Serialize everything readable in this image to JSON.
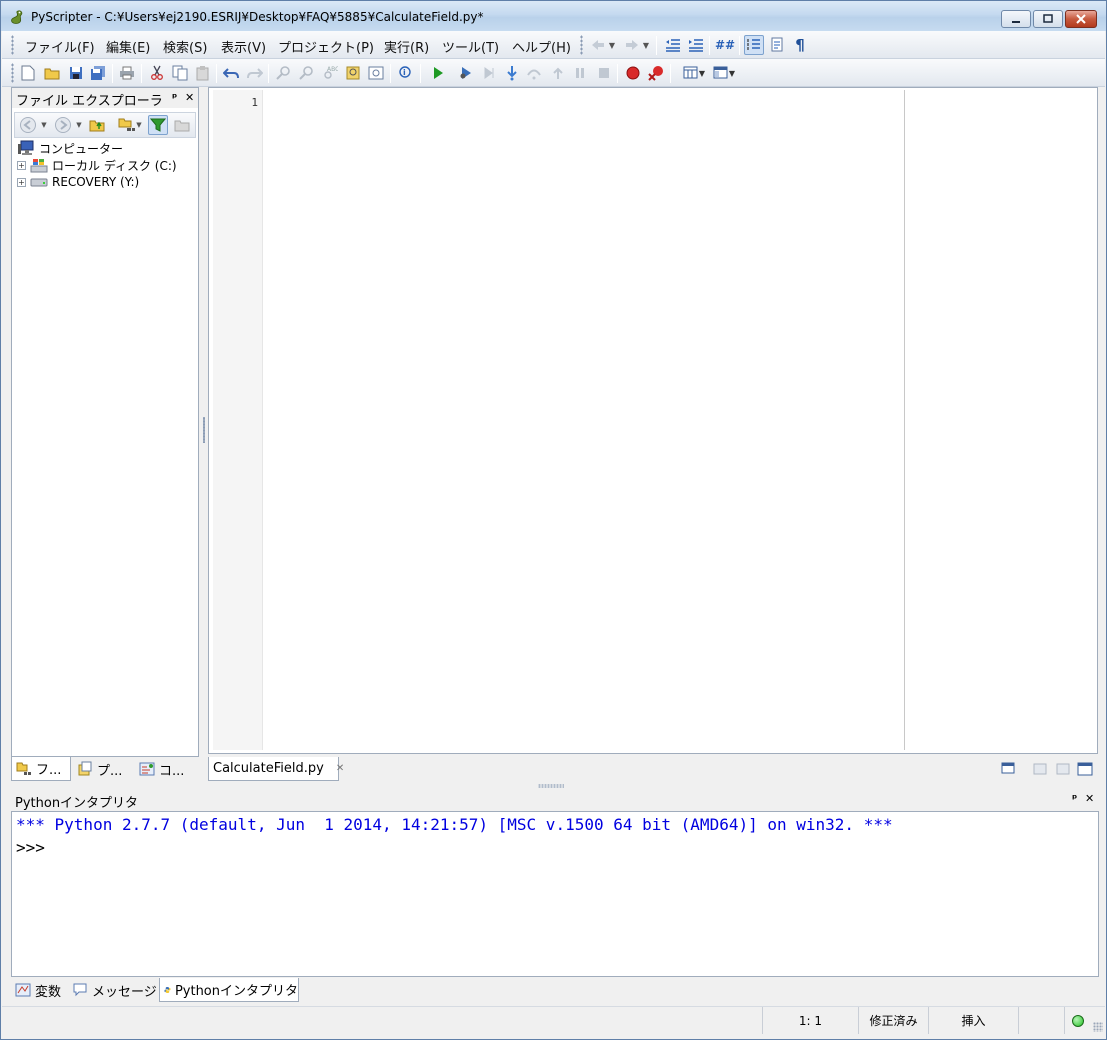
{
  "window": {
    "title": "PyScripter - C:¥Users¥ej2190.ESRIJ¥Desktop¥FAQ¥5885¥CalculateField.py*",
    "app_icon": "pyscripter-snake-icon"
  },
  "menu": {
    "items": [
      "ファイル(F)",
      "編集(E)",
      "検索(S)",
      "表示(V)",
      "プロジェクト(P)",
      "実行(R)",
      "ツール(T)",
      "ヘルプ(H)"
    ]
  },
  "file_explorer": {
    "title": "ファイル エクスプローラ",
    "tree": [
      {
        "label": "コンピューター",
        "icon": "computer-icon"
      },
      {
        "label": "ローカル ディスク (C:)",
        "icon": "local-disk-icon"
      },
      {
        "label": "RECOVERY (Y:)",
        "icon": "drive-icon"
      }
    ]
  },
  "left_tabs": [
    {
      "label": "フ...",
      "icon": "file-explorer-tab-icon"
    },
    {
      "label": "プ...",
      "icon": "project-tab-icon"
    },
    {
      "label": "コ...",
      "icon": "code-explorer-tab-icon"
    }
  ],
  "editor": {
    "line_numbers": [
      "1"
    ],
    "tab_label": "CalculateField.py"
  },
  "interpreter": {
    "title": "Pythonインタプリタ",
    "banner": "*** Python 2.7.7 (default, Jun  1 2014, 14:21:57) [MSC v.1500 64 bit (AMD64)] on win32. ***",
    "prompt": ">>>",
    "banner_color": "#0000e0"
  },
  "bottom_tabs": [
    {
      "label": "変数",
      "icon": "variables-icon"
    },
    {
      "label": "メッセージ",
      "icon": "messages-icon"
    },
    {
      "label": "Pythonインタプリタ",
      "icon": "python-icon"
    }
  ],
  "status": {
    "position": "1: 1",
    "modified": "修正済み",
    "mode": "挿入",
    "indicator_color": "#22c022"
  }
}
